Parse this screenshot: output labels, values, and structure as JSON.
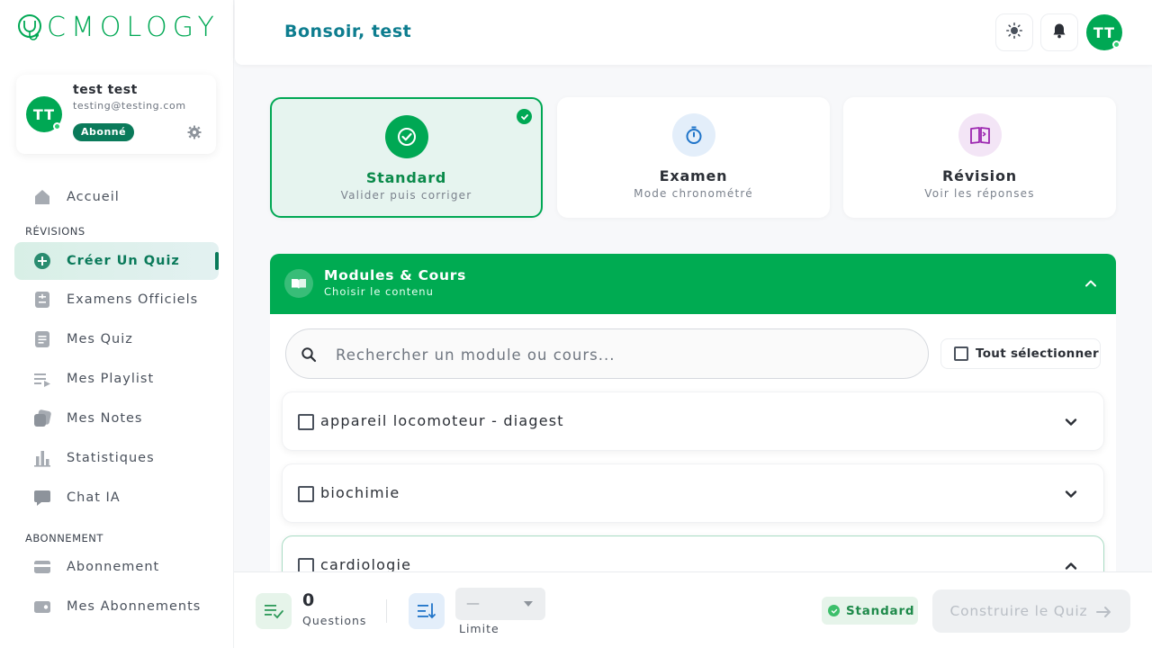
{
  "brand": {
    "name": "CMOLOGY",
    "accent": "#00a854"
  },
  "user": {
    "initials": "TT",
    "name": "test test",
    "email": "testing@testing.com",
    "status_badge": "Abonné"
  },
  "sidebar": {
    "items": [
      {
        "label": "Accueil",
        "icon": "home-icon"
      },
      {
        "section": "RÉVISIONS"
      },
      {
        "label": "Créer Un Quiz",
        "icon": "plus-circle-icon",
        "active": true
      },
      {
        "label": "Examens Officiels",
        "icon": "calculator-icon"
      },
      {
        "label": "Mes Quiz",
        "icon": "document-icon"
      },
      {
        "label": "Mes Playlist",
        "icon": "playlist-icon"
      },
      {
        "label": "Mes Notes",
        "icon": "notes-icon"
      },
      {
        "label": "Statistiques",
        "icon": "bar-chart-icon"
      },
      {
        "label": "Chat IA",
        "icon": "chat-icon"
      },
      {
        "section": "ABONNEMENT"
      },
      {
        "label": "Abonnement",
        "icon": "credit-card-icon"
      },
      {
        "label": "Mes Abonnements",
        "icon": "wallet-icon"
      }
    ]
  },
  "header": {
    "greeting": "Bonsoir, test"
  },
  "modes": [
    {
      "title": "Standard",
      "subtitle": "Valider puis corriger",
      "selected": true,
      "icon": "check-circle-icon"
    },
    {
      "title": "Examen",
      "subtitle": "Mode chronométré",
      "selected": false,
      "icon": "stopwatch-icon"
    },
    {
      "title": "Révision",
      "subtitle": "Voir les réponses",
      "selected": false,
      "icon": "open-book-icon"
    }
  ],
  "modules_panel": {
    "title": "Modules & Cours",
    "subtitle": "Choisir le contenu",
    "search_placeholder": "Rechercher un module ou cours...",
    "select_all_label": "Tout sélectionner",
    "modules": [
      "appareil locomoteur - diagest",
      "biochimie",
      "cardiologie"
    ]
  },
  "bottom_bar": {
    "question_count": "0",
    "question_label": "Questions",
    "limit_value": "—",
    "limit_label": "Limite",
    "mode_label": "Standard",
    "build_button": "Construire le Quiz"
  }
}
